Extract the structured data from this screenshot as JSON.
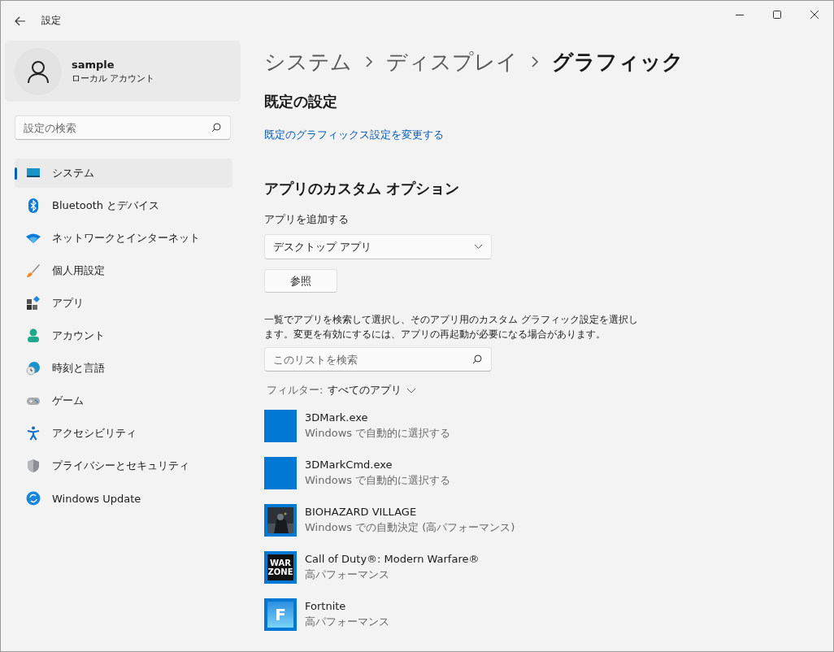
{
  "window": {
    "title": "設定"
  },
  "profile": {
    "name": "sample",
    "account": "ローカル アカウント"
  },
  "search": {
    "placeholder": "設定の検索"
  },
  "sidebar": {
    "items": [
      {
        "label": "システム",
        "selected": true
      },
      {
        "label": "Bluetooth とデバイス",
        "selected": false
      },
      {
        "label": "ネットワークとインターネット",
        "selected": false
      },
      {
        "label": "個人用設定",
        "selected": false
      },
      {
        "label": "アプリ",
        "selected": false
      },
      {
        "label": "アカウント",
        "selected": false
      },
      {
        "label": "時刻と言語",
        "selected": false
      },
      {
        "label": "ゲーム",
        "selected": false
      },
      {
        "label": "アクセシビリティ",
        "selected": false
      },
      {
        "label": "プライバシーとセキュリティ",
        "selected": false
      },
      {
        "label": "Windows Update",
        "selected": false
      }
    ]
  },
  "breadcrumb": [
    "システム",
    "ディスプレイ",
    "グラフィック"
  ],
  "default_section": {
    "heading": "既定の設定",
    "link": "既定のグラフィックス設定を変更する"
  },
  "custom_section": {
    "heading": "アプリのカスタム オプション",
    "add_label": "アプリを追加する",
    "dropdown_value": "デスクトップ アプリ",
    "browse_button": "参照",
    "description": "一覧でアプリを検索して選択し、そのアプリ用のカスタム グラフィック設定を選択します。変更を有効にするには、アプリの再起動が必要になる場合があります。",
    "list_search_placeholder": "このリストを検索",
    "filter_label": "フィルター:",
    "filter_value": "すべてのアプリ"
  },
  "apps": [
    {
      "name": "3DMark.exe",
      "setting": "Windows で自動的に選択する",
      "icon": {
        "kind": "blank"
      }
    },
    {
      "name": "3DMarkCmd.exe",
      "setting": "Windows で自動的に選択する",
      "icon": {
        "kind": "blank"
      }
    },
    {
      "name": "BIOHAZARD VILLAGE",
      "setting": "Windows での自動決定 (高パフォーマンス)"
    },
    {
      "name": "Call of Duty®: Modern Warfare®",
      "setting": "高パフォーマンス",
      "icon": {
        "kind": "dark_logo",
        "text": [
          "WAR",
          "ZONE"
        ]
      }
    },
    {
      "name": "Fortnite",
      "setting": "高パフォーマンス",
      "icon": {
        "kind": "light_logo",
        "text": [
          "F"
        ]
      }
    }
  ]
}
